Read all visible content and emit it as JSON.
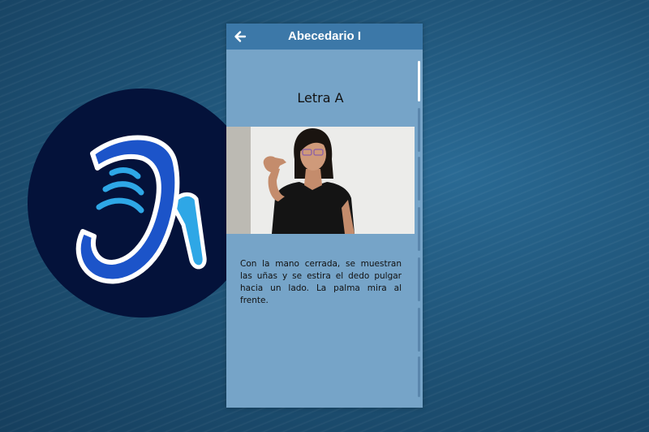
{
  "logo": {
    "icon": "sign-language-j-logo-icon",
    "colors": {
      "circle": "#04123a",
      "primary": "#1c54c9",
      "accent": "#2ea7e6",
      "outline": "#ffffff"
    }
  },
  "appbar": {
    "title": "Abecedario I",
    "back_icon": "arrow-left-icon",
    "color": "#3c78a8"
  },
  "lesson": {
    "letter_title": "Letra A",
    "video": {
      "content": "person-signing-letter-a",
      "background": "#ececea"
    },
    "description": "Con la mano cerrada, se muestran las uñas y se estira el dedo pulgar hacia un lado. La palma mira al frente."
  },
  "theme": {
    "panel_background": "#76a4c8",
    "page_background": "#1f5478",
    "scroll_thumb": "#ffffff"
  }
}
